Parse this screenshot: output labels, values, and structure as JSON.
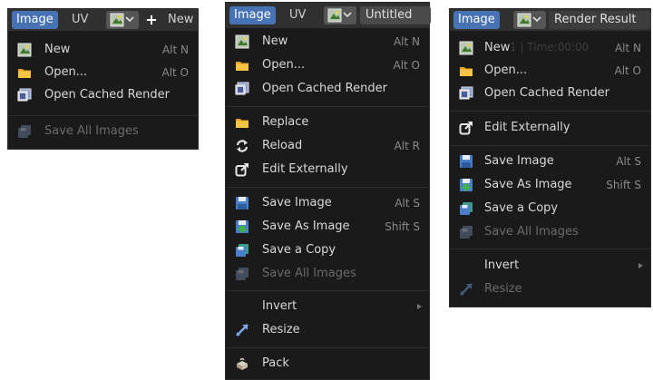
{
  "panel1": {
    "header": {
      "tab_image": "Image",
      "tab_uv": "UV",
      "new_label": "New"
    },
    "items": [
      {
        "label": "New",
        "shortcut": "Alt N",
        "icon": "image-new-icon",
        "disabled": false
      },
      {
        "label": "Open...",
        "shortcut": "Alt O",
        "icon": "folder-icon",
        "disabled": false
      },
      {
        "label": "Open Cached Render",
        "shortcut": "",
        "icon": "cached-render-icon",
        "disabled": false
      },
      {
        "label": "Save All Images",
        "shortcut": "",
        "icon": "save-all-icon",
        "disabled": true
      }
    ]
  },
  "panel2": {
    "header": {
      "tab_image": "Image",
      "tab_uv": "UV",
      "image_name": "Untitled"
    },
    "items": [
      {
        "label": "New",
        "shortcut": "Alt N",
        "icon": "image-new-icon",
        "disabled": false
      },
      {
        "label": "Open...",
        "shortcut": "Alt O",
        "icon": "folder-icon",
        "disabled": false
      },
      {
        "label": "Open Cached Render",
        "shortcut": "",
        "icon": "cached-render-icon",
        "disabled": false
      },
      {
        "label": "Replace",
        "shortcut": "",
        "icon": "folder-icon",
        "disabled": false
      },
      {
        "label": "Reload",
        "shortcut": "Alt R",
        "icon": "reload-icon",
        "disabled": false
      },
      {
        "label": "Edit Externally",
        "shortcut": "",
        "icon": "edit-external-icon",
        "disabled": false
      },
      {
        "label": "Save Image",
        "shortcut": "Alt S",
        "icon": "save-icon",
        "disabled": false
      },
      {
        "label": "Save As Image",
        "shortcut": "Shift S",
        "icon": "save-as-icon",
        "disabled": false
      },
      {
        "label": "Save a Copy",
        "shortcut": "",
        "icon": "save-copy-icon",
        "disabled": false
      },
      {
        "label": "Save All Images",
        "shortcut": "",
        "icon": "save-all-icon",
        "disabled": true
      },
      {
        "label": "Invert",
        "shortcut": "",
        "icon": "",
        "disabled": false,
        "submenu": true
      },
      {
        "label": "Resize",
        "shortcut": "",
        "icon": "resize-icon",
        "disabled": false
      },
      {
        "label": "Pack",
        "shortcut": "",
        "icon": "pack-icon",
        "disabled": false
      }
    ]
  },
  "panel3": {
    "header": {
      "tab_image": "Image",
      "image_name": "Render Result"
    },
    "items": [
      {
        "label": "New",
        "shortcut": "Alt N",
        "icon": "image-new-icon",
        "disabled": false
      },
      {
        "label": "Open...",
        "shortcut": "Alt O",
        "icon": "folder-icon",
        "disabled": false
      },
      {
        "label": "Open Cached Render",
        "shortcut": "",
        "icon": "cached-render-icon",
        "disabled": false
      },
      {
        "label": "Edit Externally",
        "shortcut": "",
        "icon": "edit-external-icon",
        "disabled": false
      },
      {
        "label": "Save Image",
        "shortcut": "Alt S",
        "icon": "save-icon",
        "disabled": false
      },
      {
        "label": "Save As Image",
        "shortcut": "Shift S",
        "icon": "save-as-icon",
        "disabled": false
      },
      {
        "label": "Save a Copy",
        "shortcut": "",
        "icon": "save-copy-icon",
        "disabled": false
      },
      {
        "label": "Save All Images",
        "shortcut": "",
        "icon": "save-all-icon",
        "disabled": true
      },
      {
        "label": "Invert",
        "shortcut": "",
        "icon": "",
        "disabled": false,
        "submenu": true
      },
      {
        "label": "Resize",
        "shortcut": "",
        "icon": "resize-icon",
        "disabled": true
      }
    ],
    "background_text": "1 | Time:00:00"
  },
  "colors": {
    "accent": "#4772b3",
    "menu_bg": "#1a1a1a",
    "header_bg": "#303030",
    "text": "#d8d8d8",
    "shortcut": "#8a8a8a",
    "disabled": "#6a6a6a"
  }
}
